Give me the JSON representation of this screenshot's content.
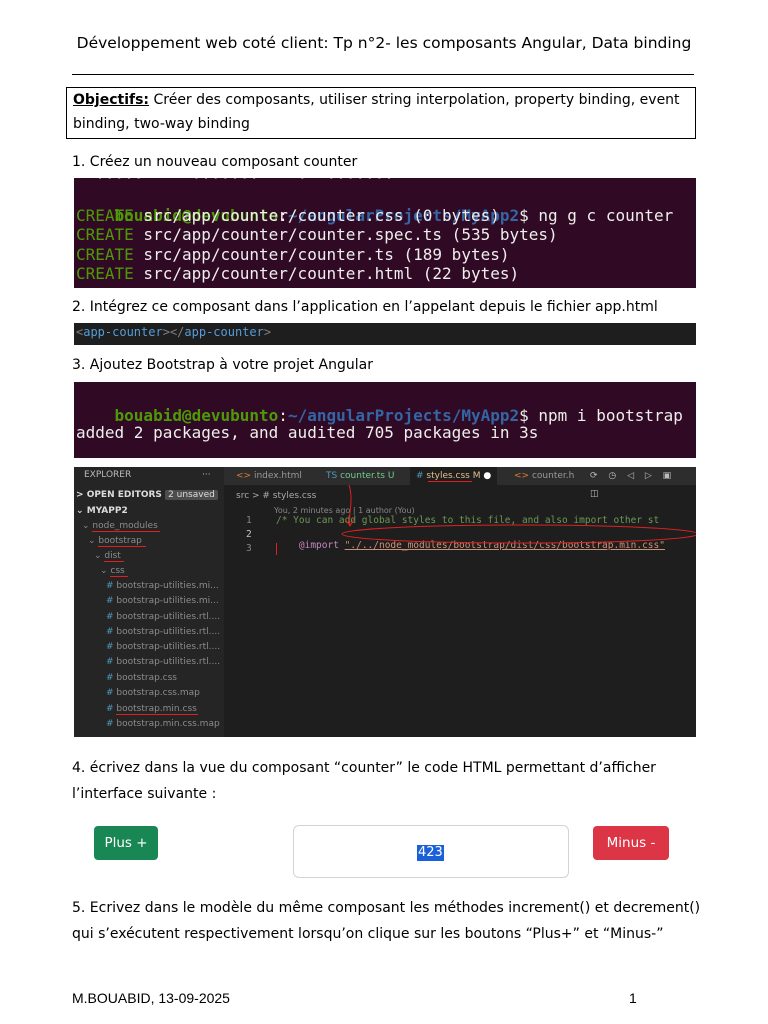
{
  "doc": {
    "title": "Développement web coté client:  Tp n°2- les composants Angular, Data binding",
    "objectives_label": "Objectifs:",
    "objectives_text": " Créer des composants, utiliser string interpolation, property binding, event binding, two-way binding",
    "step1": "1. Créez  un nouveau composant counter",
    "step2": "2. Intégrez ce composant dans l’application en l’appelant depuis le fichier app.html",
    "step3": "3. Ajoutez Bootstrap à votre projet Angular",
    "step4_line1": "4. écrivez dans la vue du composant “counter” le code HTML permettant d’afficher",
    "step4_line2": "l’interface suivante :",
    "step5_line1": "5. Ecrivez dans le modèle du même composant les méthodes increment() et decrement()",
    "step5_line2": "qui s’exécutent respectivement lorsqu’on clique sur les boutons “Plus+” et “Minus-”",
    "footer_left": "M.BOUABID, 13-09-2025",
    "footer_page": "1"
  },
  "terminal1": {
    "user": "bouabid@devubunto",
    "path": "~/angularProjects/MyApp2",
    "command": "$ ng g c counter",
    "create_word": "CREATE",
    "lines": [
      " src/app/counter/counter.css (0 bytes)",
      " src/app/counter/counter.spec.ts (535 bytes)",
      " src/app/counter/counter.ts (189 bytes)",
      " src/app/counter/counter.html (22 bytes)"
    ]
  },
  "codebar": {
    "open_tag": "app-counter",
    "close_tag": "app-counter"
  },
  "terminal2": {
    "user": "bouabid@devubunto",
    "path": "~/angularProjects/MyApp2",
    "command": "$ npm i bootstrap",
    "output": "added 2 packages, and audited 705 packages in 3s"
  },
  "vscode": {
    "explorer_label": "EXPLORER",
    "dots": "···",
    "open_editors": "OPEN EDITORS",
    "unsaved_badge": "2 unsaved",
    "project": "MYAPP2",
    "tabs": [
      "index.html",
      "counter.ts U",
      "styles.css M",
      "counter.h"
    ],
    "breadcrumb": "src  >  #  styles.css",
    "blame": "You, 2 minutes ago | 1 author (You)",
    "code_line1": "/* You can add global styles to this file, and also import other st",
    "code_line2_kw": "@import",
    "code_line2_str": "\"./../node_modules/bootstrap/dist/css/bootstrap.min.css\"",
    "line_numbers": [
      "1",
      "2",
      "3"
    ],
    "tree": [
      "node_modules",
      "bootstrap",
      "dist",
      "css",
      "bootstrap-utilities.mi...",
      "bootstrap-utilities.mi...",
      "bootstrap-utilities.rtl....",
      "bootstrap-utilities.rtl....",
      "bootstrap-utilities.rtl....",
      "bootstrap-utilities.rtl....",
      "bootstrap.css",
      "bootstrap.css.map",
      "bootstrap.min.css",
      "bootstrap.min.css.map"
    ]
  },
  "counter_ui": {
    "plus_label": "Plus +",
    "minus_label": "Minus -",
    "value": "423",
    "plus_color": "#198754",
    "minus_color": "#dc3545"
  }
}
